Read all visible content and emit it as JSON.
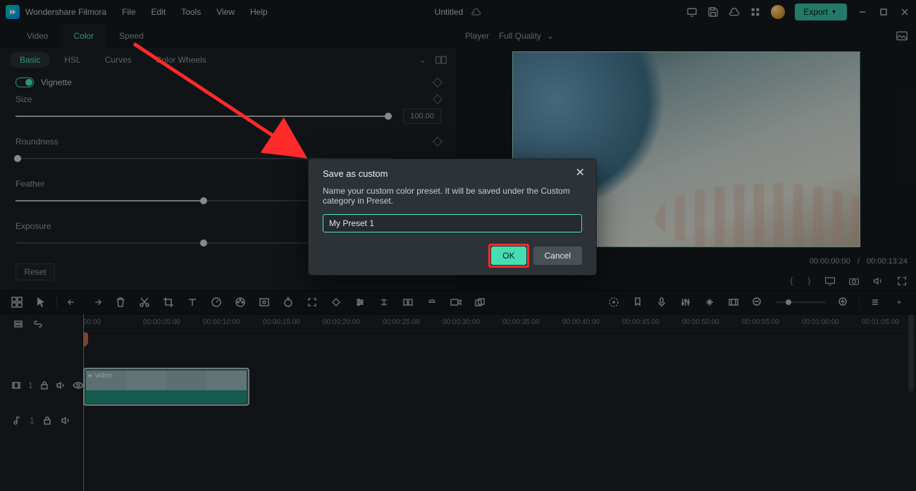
{
  "app": {
    "name": "Wondershare Filmora"
  },
  "menu": {
    "file": "File",
    "edit": "Edit",
    "tools": "Tools",
    "view": "View",
    "help": "Help"
  },
  "project": {
    "title": "Untitled"
  },
  "export": {
    "label": "Export"
  },
  "leftTabs": {
    "video": "Video",
    "color": "Color",
    "speed": "Speed"
  },
  "subTabs": {
    "basic": "Basic",
    "hsl": "HSL",
    "curves": "Curves",
    "colorWheels": "Color Wheels"
  },
  "vignette": {
    "label": "Vignette",
    "size": {
      "label": "Size",
      "value": "100.00",
      "percent": 100
    },
    "roundness": {
      "label": "Roundness",
      "percent": 0
    },
    "feather": {
      "label": "Feather",
      "percent": 50
    },
    "exposure": {
      "label": "Exposure",
      "percent": 50
    }
  },
  "reset": {
    "label": "Reset"
  },
  "player": {
    "label": "Player",
    "quality": "Full Quality",
    "current": "00:00:00:00",
    "duration": "00:00:13:24"
  },
  "timeline": {
    "ticks": [
      "00:00",
      "00:00:05:00",
      "00:00:10:00",
      "00:00:15:00",
      "00:00:20:00",
      "00:00:25:00",
      "00:00:30:00",
      "00:00:35:00",
      "00:00:40:00",
      "00:00:45:00",
      "00:00:50:00",
      "00:00:55:00",
      "00:01:00:00",
      "00:01:05:00"
    ],
    "videoTrack": "1",
    "audioTrack": "1",
    "clipLabel": "video"
  },
  "dialog": {
    "title": "Save as custom",
    "desc": "Name your custom color preset. It will be saved under the Custom category in Preset.",
    "value": "My Preset 1",
    "ok": "OK",
    "cancel": "Cancel"
  }
}
